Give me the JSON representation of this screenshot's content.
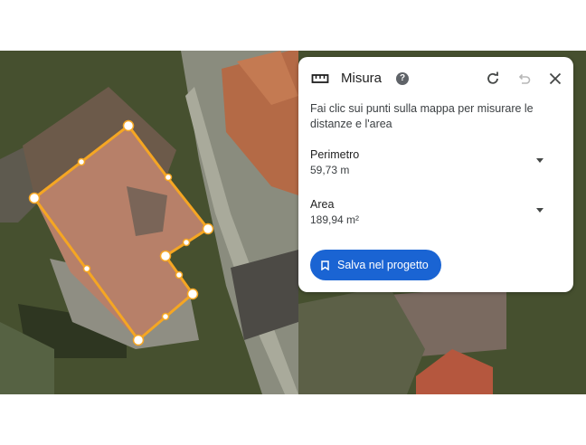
{
  "panel": {
    "title": "Misura",
    "description": "Fai clic sui punti sulla mappa per misurare le distanze e l'area",
    "perimeter": {
      "label": "Perimetro",
      "value": "59,73 m"
    },
    "area": {
      "label": "Area",
      "value": "189,94 m²"
    },
    "save_label": "Salva nel progetto",
    "icons": [
      "ruler-icon",
      "help-icon",
      "redo-icon",
      "undo-icon",
      "close-icon",
      "bookmark-icon",
      "chevron-down-icon"
    ]
  },
  "colors": {
    "accent": "#1a64d3",
    "measure_line": "#f5a623",
    "panel_bg": "#ffffff"
  }
}
